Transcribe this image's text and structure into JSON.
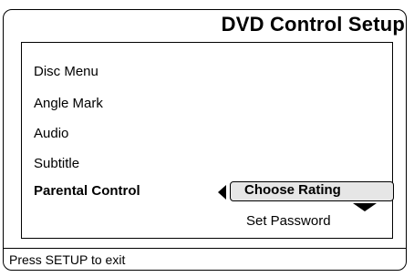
{
  "header": {
    "title": "DVD Control Setup"
  },
  "menu": {
    "items": [
      {
        "label": "Disc Menu"
      },
      {
        "label": "Angle Mark"
      },
      {
        "label": "Audio"
      },
      {
        "label": "Subtitle"
      },
      {
        "label": "Parental Control"
      }
    ]
  },
  "submenu": {
    "selected": "Choose Rating",
    "options": [
      "Set Password"
    ]
  },
  "footer": {
    "status": "Press SETUP to exit"
  }
}
